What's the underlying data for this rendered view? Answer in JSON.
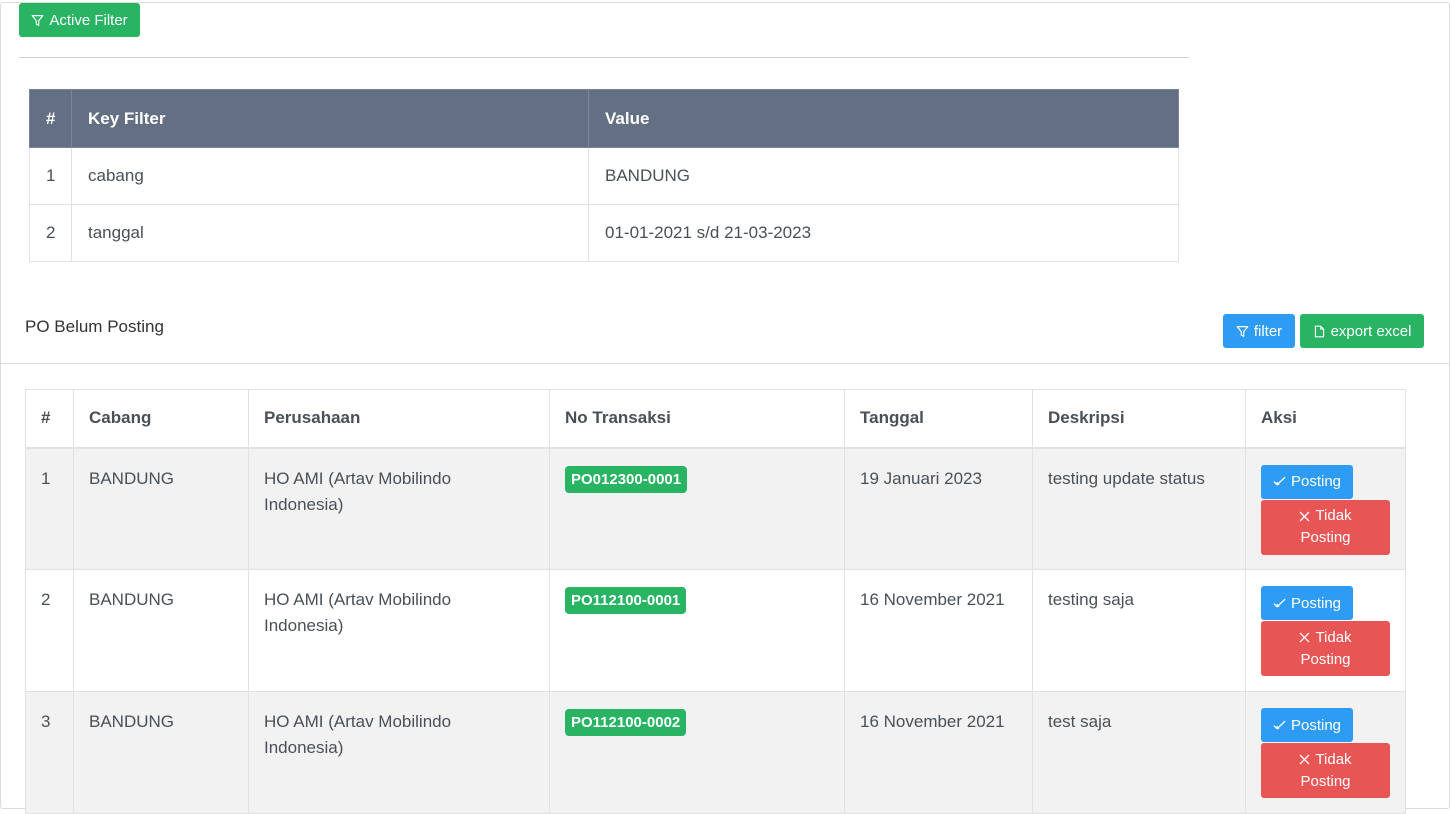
{
  "active_filter": {
    "button_label": "Active Filter",
    "icon": "filter-icon",
    "color": "#28b463"
  },
  "filter_table": {
    "headers": [
      "#",
      "Key Filter",
      "Value"
    ],
    "rows": [
      {
        "no": "1",
        "key": "cabang",
        "value": "BANDUNG"
      },
      {
        "no": "2",
        "key": "tanggal",
        "value": "01-01-2021 s/d 21-03-2023"
      }
    ],
    "header_color": "#637083"
  },
  "section": {
    "title": "PO Belum Posting",
    "filter_label": "filter",
    "export_label": "export excel"
  },
  "po_table": {
    "headers": [
      "#",
      "Cabang",
      "Perusahaan",
      "No Transaksi",
      "Tanggal",
      "Deskripsi",
      "Aksi"
    ],
    "rows": [
      {
        "no": "1",
        "cabang": "BANDUNG",
        "perusahaan": "HO AMI (Artav Mobilindo Indonesia)",
        "no_transaksi": "PO012300-0001",
        "tanggal": "19 Januari 2023",
        "deskripsi": "testing update status"
      },
      {
        "no": "2",
        "cabang": "BANDUNG",
        "perusahaan": "HO AMI (Artav Mobilindo Indonesia)",
        "no_transaksi": "PO112100-0001",
        "tanggal": "16 November 2021",
        "deskripsi": "testing saja"
      },
      {
        "no": "3",
        "cabang": "BANDUNG",
        "perusahaan": "HO AMI (Artav Mobilindo Indonesia)",
        "no_transaksi": "PO112100-0002",
        "tanggal": "16 November 2021",
        "deskripsi": "test saja"
      }
    ],
    "actions": {
      "posting_label": "Posting",
      "tidak_line1": "Tidak",
      "tidak_line2": "Posting"
    }
  },
  "colors": {
    "green": "#28b463",
    "blue": "#2e9cf5",
    "red": "#e85555"
  }
}
